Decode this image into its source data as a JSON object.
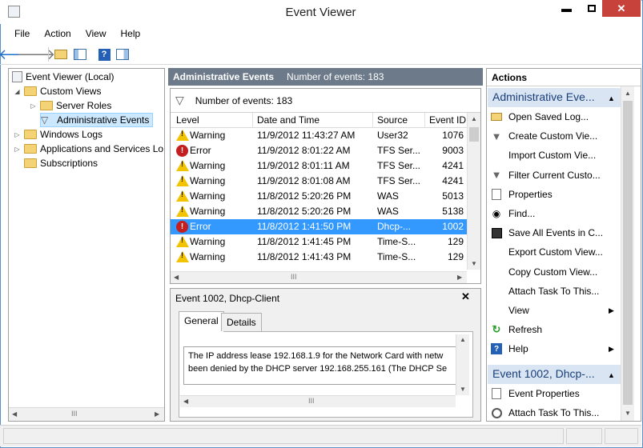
{
  "window": {
    "title": "Event Viewer"
  },
  "menu": {
    "items": [
      "File",
      "Action",
      "View",
      "Help"
    ]
  },
  "toolbar": {
    "icons": [
      "back-arrow-icon",
      "forward-arrow-icon",
      "up-folder-icon",
      "show-hide-console-tree-icon",
      "help-icon",
      "show-hide-action-pane-icon"
    ]
  },
  "tree": {
    "root": "Event Viewer (Local)",
    "custom_views": "Custom Views",
    "server_roles": "Server Roles",
    "admin_events": "Administrative Events",
    "windows_logs": "Windows Logs",
    "app_services": "Applications and Services Lo",
    "subscriptions": "Subscriptions"
  },
  "center": {
    "header": "Administrative Events",
    "header_count": "Number of events: 183",
    "filter_count": "Number of events: 183",
    "columns": [
      "Level",
      "Date and Time",
      "Source",
      "Event ID"
    ],
    "rows": [
      {
        "level": "Warning",
        "date": "11/9/2012 11:43:27 AM",
        "source": "User32",
        "id": "1076",
        "type": "warning"
      },
      {
        "level": "Error",
        "date": "11/9/2012 8:01:22 AM",
        "source": "TFS Ser...",
        "id": "9003",
        "type": "error"
      },
      {
        "level": "Warning",
        "date": "11/9/2012 8:01:11 AM",
        "source": "TFS Ser...",
        "id": "4241",
        "type": "warning"
      },
      {
        "level": "Warning",
        "date": "11/9/2012 8:01:08 AM",
        "source": "TFS Ser...",
        "id": "4241",
        "type": "warning"
      },
      {
        "level": "Warning",
        "date": "11/8/2012 5:20:26 PM",
        "source": "WAS",
        "id": "5013",
        "type": "warning"
      },
      {
        "level": "Warning",
        "date": "11/8/2012 5:20:26 PM",
        "source": "WAS",
        "id": "5138",
        "type": "warning"
      },
      {
        "level": "Error",
        "date": "11/8/2012 1:41:50 PM",
        "source": "Dhcp-...",
        "id": "1002",
        "type": "error",
        "selected": true
      },
      {
        "level": "Warning",
        "date": "11/8/2012 1:41:45 PM",
        "source": "Time-S...",
        "id": "129",
        "type": "warning"
      },
      {
        "level": "Warning",
        "date": "11/8/2012 1:41:43 PM",
        "source": "Time-S...",
        "id": "129",
        "type": "warning"
      }
    ]
  },
  "detail": {
    "title": "Event 1002, Dhcp-Client",
    "tabs": [
      "General",
      "Details"
    ],
    "text_line1": "The IP address lease 192.168.1.9 for the Network Card with netw",
    "text_line2": "been denied by the DHCP server 192.168.255.161 (The DHCP Se"
  },
  "actions": {
    "title": "Actions",
    "group1": "Administrative Eve...",
    "items1": [
      {
        "label": "Open Saved Log...",
        "icon": "open-folder-icon"
      },
      {
        "label": "Create Custom Vie...",
        "icon": "filter-icon"
      },
      {
        "label": "Import Custom Vie...",
        "icon": ""
      },
      {
        "label": "Filter Current Custo...",
        "icon": "filter-icon"
      },
      {
        "label": "Properties",
        "icon": "properties-icon"
      },
      {
        "label": "Find...",
        "icon": "binoculars-icon"
      },
      {
        "label": "Save All Events in C...",
        "icon": "save-icon"
      },
      {
        "label": "Export Custom View...",
        "icon": ""
      },
      {
        "label": "Copy Custom View...",
        "icon": ""
      },
      {
        "label": "Attach Task To This...",
        "icon": ""
      },
      {
        "label": "View",
        "icon": "",
        "submenu": true
      },
      {
        "label": "Refresh",
        "icon": "refresh-icon"
      },
      {
        "label": "Help",
        "icon": "help-icon",
        "submenu": true
      }
    ],
    "group2": "Event 1002, Dhcp-...",
    "items2": [
      {
        "label": "Event Properties",
        "icon": "properties-icon"
      },
      {
        "label": "Attach Task To This...",
        "icon": "task-clock-icon"
      }
    ]
  },
  "colors": {
    "selection": "#3399ff",
    "header_bg": "#6d7a8a",
    "group_bg": "#d9e5f3",
    "close_red": "#c7423a"
  }
}
